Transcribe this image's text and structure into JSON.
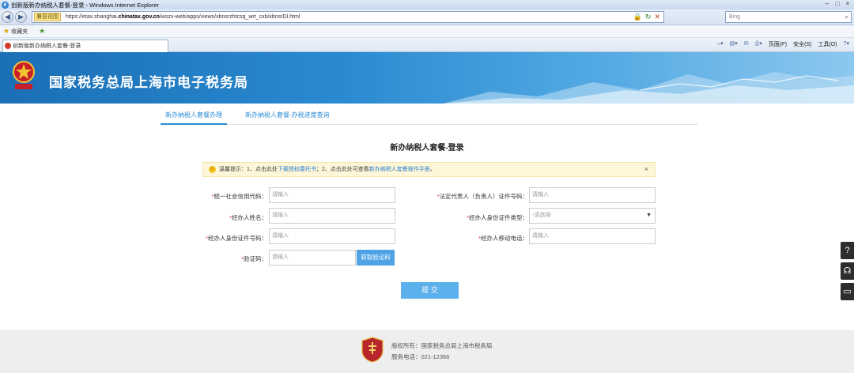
{
  "browser": {
    "window_title": "创新版新办纳税人套餐-登录 - Windows Internet Explorer",
    "compat_badge": "兼容视图",
    "url_prefix": "https://etax.shanghai.",
    "url_host": "chinatax.gov.cn",
    "url_path": "/wszx-web/apps/views/xbnsrzhtcsq_wrt_cxb/xbnsrDl.html",
    "search_placeholder": "Bing",
    "favorites_label": "收藏夹",
    "tab_title": "创新版新办纳税人套餐-登录",
    "cmd_page": "页面(P)",
    "cmd_safety": "安全(S)",
    "cmd_tools": "工具(O)"
  },
  "header": {
    "site_name": "国家税务总局上海市电子税务局"
  },
  "tabs": [
    {
      "label": "新办纳税人套餐办理"
    },
    {
      "label": "新办纳税人套餐-办税进度查询"
    }
  ],
  "form": {
    "title": "新办纳税人套餐-登录",
    "notice_prefix": "温馨提示：1、点击此处",
    "notice_link1": "下载授权委托书",
    "notice_mid": "；2、点击此处可查看",
    "notice_link2": "新办纳税人套餐操作手册",
    "notice_suffix": "。",
    "notice_close": "×",
    "fields": {
      "credit_code": {
        "label": "统一社会信用代码：",
        "placeholder": "请输入"
      },
      "agent_name": {
        "label": "经办人姓名：",
        "placeholder": "请输入"
      },
      "agent_id_no": {
        "label": "经办人身份证件号码：",
        "placeholder": "请输入"
      },
      "captcha": {
        "label": "验证码：",
        "placeholder": "请输入"
      },
      "legal_id_no": {
        "label": "法定代表人（负责人）证件号码：",
        "placeholder": "请输入"
      },
      "agent_id_type": {
        "label": "经办人身份证件类型：",
        "value": "-请选择-"
      },
      "agent_phone": {
        "label": "经办人移动电话：",
        "placeholder": "请输入"
      }
    },
    "captcha_button": "获取验证码",
    "submit_button": "提 交"
  },
  "footer": {
    "copyright": "版权所有：国家税务总局上海市税务局",
    "hotline": "服务电话：021-12366"
  }
}
